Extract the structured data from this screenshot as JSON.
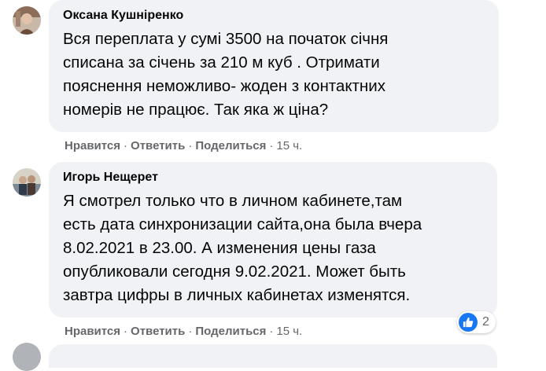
{
  "comments": [
    {
      "author": "Оксана Кушніренко",
      "text": "Вся переплата у сумі 3500 на початок січня\nсписана за січень за 210 м куб . Отримати\nпояснення неможливо- жоден з контактних\nномерів не працює. Так яка ж ціна?",
      "like_label": "Нравится",
      "reply_label": "Ответить",
      "share_label": "Поделиться",
      "time": "15 ч."
    },
    {
      "author": "Игорь Нещерет",
      "text": "Я смотрел только что в личном кабинете,там\nесть дата синхронизации сайта,она была вчера\n8.02.2021 в 23.00. А изменения цены газа\nопубликовали сегодня 9.02.2021. Может быть\nзавтра цифры в личных кабинетах изменятся.",
      "like_label": "Нравится",
      "reply_label": "Ответить",
      "share_label": "Поделиться",
      "time": "15 ч.",
      "reactions": {
        "icon": "thumbs-up-icon",
        "count": "2",
        "color": "#1877f2"
      }
    }
  ],
  "separator": "·",
  "colors": {
    "bubble": "#f0f2f5",
    "meta": "#65676b",
    "text": "#050505",
    "accent": "#1877f2"
  }
}
